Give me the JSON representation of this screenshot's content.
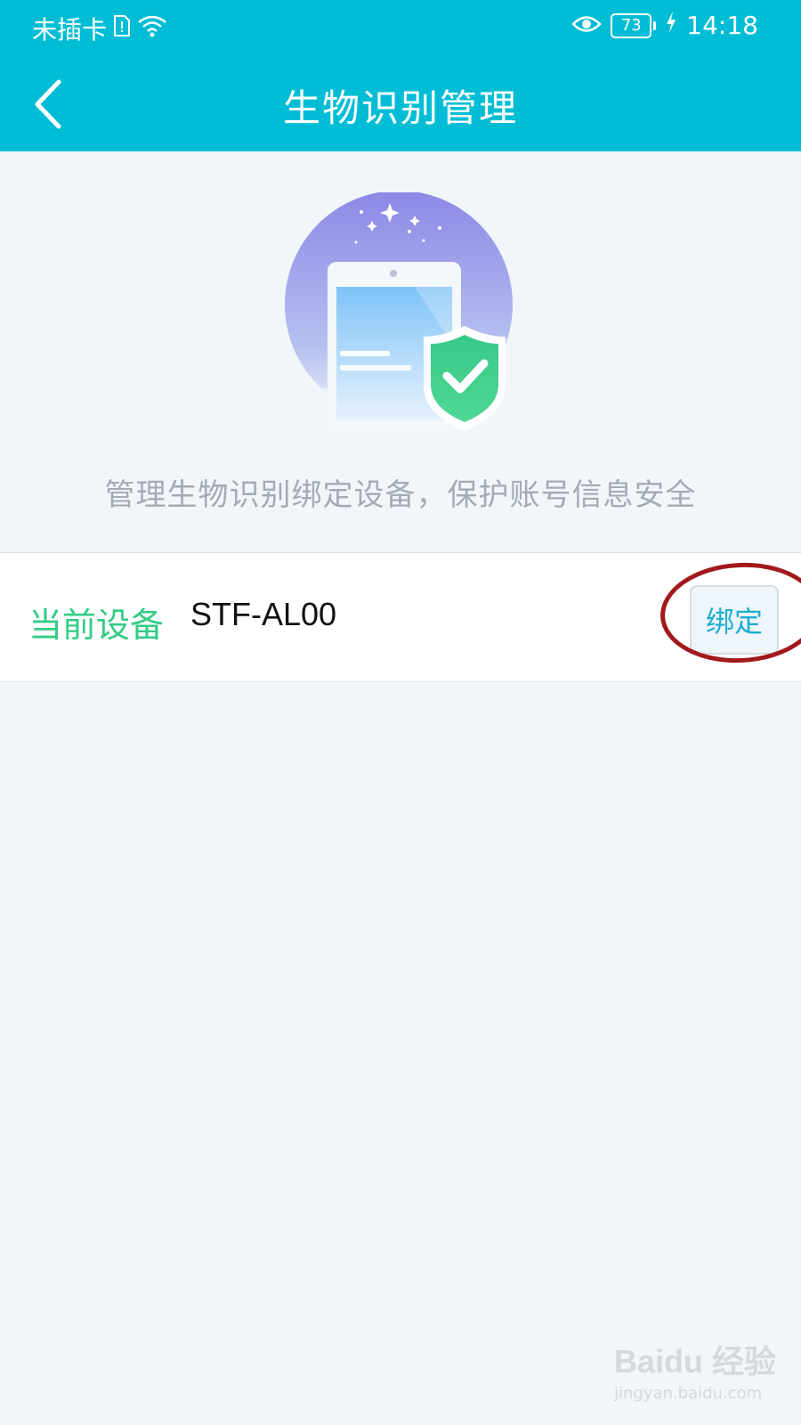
{
  "status_bar": {
    "carrier": "未插卡",
    "battery": "73",
    "time": "14:18",
    "icons": [
      "sim-alert-icon",
      "wifi-icon",
      "eye-icon",
      "battery-icon",
      "charging-icon"
    ]
  },
  "header": {
    "title": "生物识别管理",
    "back_icon": "chevron-left-icon"
  },
  "hero": {
    "icon": "phone-shield-check-illustration"
  },
  "subtitle": "管理生物识别绑定设备，保护账号信息安全",
  "device": {
    "label": "当前设备",
    "name": "STF-AL00",
    "bind_label": "绑定"
  },
  "watermark": {
    "logo": "Baidu 经验",
    "url": "jingyan.baidu.com"
  },
  "colors": {
    "header_bg": "#00bdd5",
    "page_bg": "#f0f6fa",
    "label_green": "#33cc84",
    "bind_blue": "#1baed1",
    "annotation_red": "#a3191b"
  }
}
